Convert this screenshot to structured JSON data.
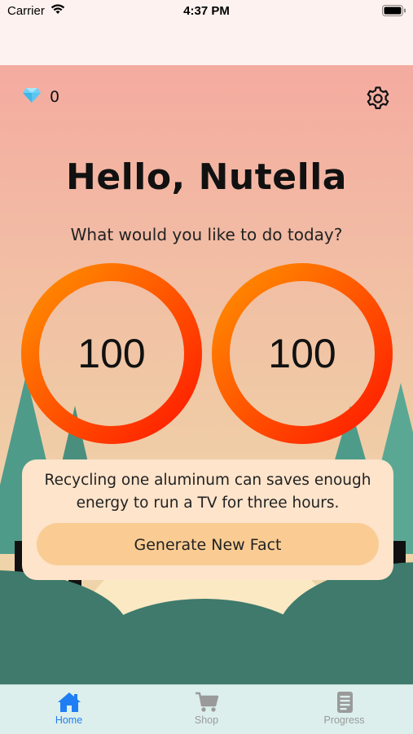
{
  "status_bar": {
    "carrier": "Carrier",
    "time": "4:37 PM"
  },
  "header": {
    "gem_count": "0",
    "gem_icon": "gem-icon",
    "settings_icon": "gear-icon"
  },
  "greeting": {
    "title": "Hello, Nutella",
    "subtitle": "What would you like to do today?"
  },
  "rings": [
    {
      "value": "100"
    },
    {
      "value": "100"
    }
  ],
  "fact_card": {
    "text": "Recycling one aluminum can saves enough energy to run a TV for three hours.",
    "button_label": "Generate New Fact"
  },
  "tab_bar": {
    "tabs": [
      {
        "label": "Home",
        "icon": "home-icon",
        "active": true
      },
      {
        "label": "Shop",
        "icon": "cart-icon",
        "active": false
      },
      {
        "label": "Progress",
        "icon": "document-icon",
        "active": false
      }
    ]
  },
  "colors": {
    "accent": "#1f7ef3",
    "ring_start": "#ff8c00",
    "ring_end": "#ff1a00",
    "card_bg": "#fde4cb",
    "button_bg": "#facc93"
  }
}
